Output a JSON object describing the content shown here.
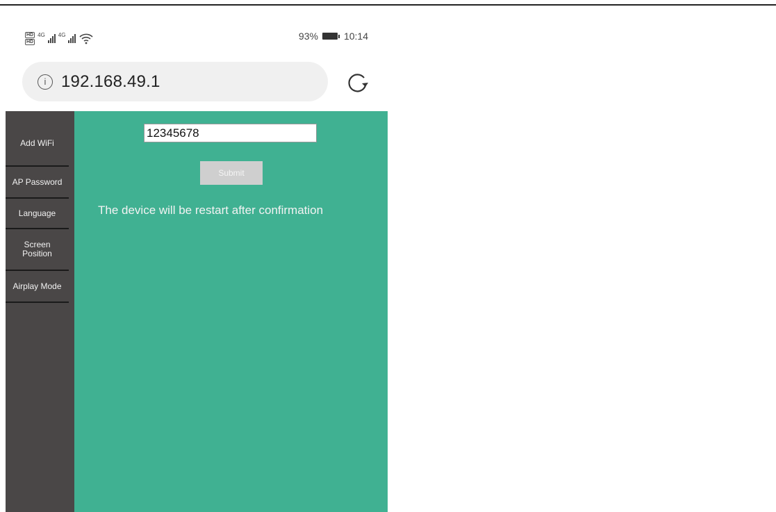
{
  "status_bar": {
    "left_icons": [
      "hd-icon",
      "4g-signal-icon",
      "4g-signal-icon",
      "wifi-icon"
    ],
    "network_labels": [
      "4G",
      "4G"
    ],
    "battery_percent": "93%",
    "time": "10:14"
  },
  "browser": {
    "url": "192.168.49.1",
    "info_icon": "info-icon",
    "reload_icon": "reload-icon"
  },
  "sidebar": {
    "items": [
      {
        "label": "Add WiFi"
      },
      {
        "label": "AP Password"
      },
      {
        "label": "Language"
      },
      {
        "label": "Screen Position"
      },
      {
        "label": "Airplay Mode"
      }
    ]
  },
  "main": {
    "password_value": "12345678",
    "submit_label": "Submit",
    "notice": "The device will be restart after confirmation"
  },
  "colors": {
    "sidebar_bg": "#4a4747",
    "main_bg": "#40b192",
    "button_bg": "#cfcfcf"
  }
}
